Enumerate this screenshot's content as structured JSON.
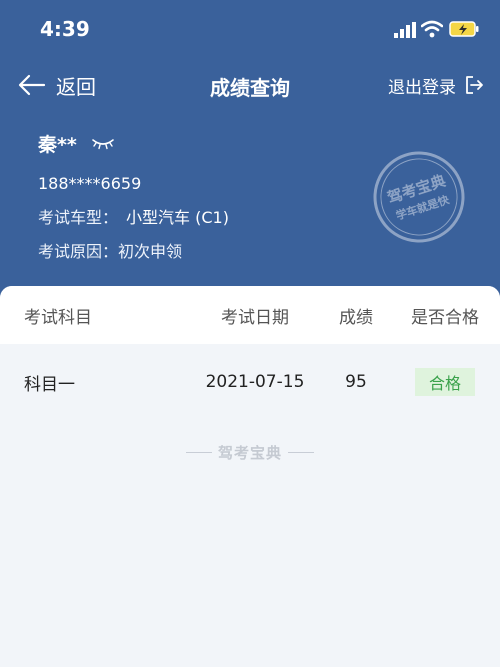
{
  "status_bar": {
    "time": "4:39"
  },
  "nav": {
    "back_label": "返回",
    "title": "成绩查询",
    "logout_label": "退出登录"
  },
  "user": {
    "name": "秦**",
    "phone": "188****6659",
    "vehicle_type_label": "考试车型：",
    "vehicle_type": "小型汽车 (C1)",
    "reason_label": "考试原因：",
    "reason": "初次申领"
  },
  "stamp": {
    "line1": "驾考宝典",
    "line2": "学车就是快"
  },
  "table": {
    "headers": [
      "考试科目",
      "考试日期",
      "成绩",
      "是否合格"
    ],
    "rows": [
      {
        "subject": "科目一",
        "date": "2021-07-15",
        "score": "95",
        "result": "合格"
      }
    ]
  },
  "footer": {
    "brand": "驾考宝典"
  },
  "colors": {
    "header_bg": "#3a619b",
    "page_bg": "#f2f5f9",
    "pass_green": "#3aa24b",
    "pass_bg": "#dff3dd"
  }
}
